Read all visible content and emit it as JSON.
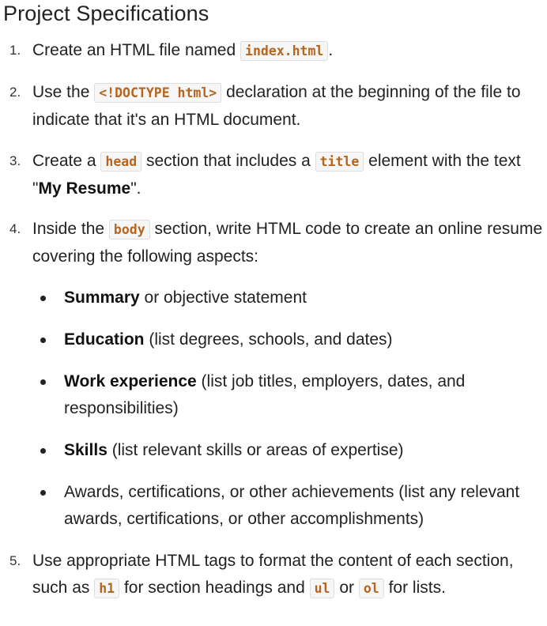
{
  "title": "Project Specifications",
  "steps": [
    {
      "number": "1.",
      "t1": "Create an HTML file named",
      "code1": "index.html",
      "t2": "."
    },
    {
      "number": "2.",
      "t1": "Use the",
      "code1": "<!DOCTYPE html>",
      "t2": "declaration at the beginning of the file to indicate that it's an HTML document."
    },
    {
      "number": "3.",
      "t1": "Create a",
      "code1": "head",
      "t2": "section that includes a",
      "code2": "title",
      "t3": "element with the text \"",
      "bold": "My Resume",
      "t4": "\"."
    },
    {
      "number": "4.",
      "t1": "Inside the",
      "code1": "body",
      "t2": "section, write HTML code to create an online resume covering the following aspects:"
    },
    {
      "number": "5.",
      "t1": "Use appropriate HTML tags to format the content of each section, such as",
      "code1": "h1",
      "t2": "for section headings and",
      "code2": "ul",
      "t3": "or",
      "code3": "ol",
      "t4": "for lists."
    }
  ],
  "aspects": [
    {
      "bold": "Summary",
      "text": " or objective statement"
    },
    {
      "bold": "Education",
      "text": " (list degrees, schools, and dates)"
    },
    {
      "bold": "Work experience",
      "text": " (list job titles, employers, dates, and responsibilities)"
    },
    {
      "bold": "Skills",
      "text": " (list relevant skills or areas of expertise)"
    },
    {
      "bold": "",
      "text": "Awards, certifications, or other achievements (list any relevant awards, certifications, or other accomplishments)"
    }
  ]
}
